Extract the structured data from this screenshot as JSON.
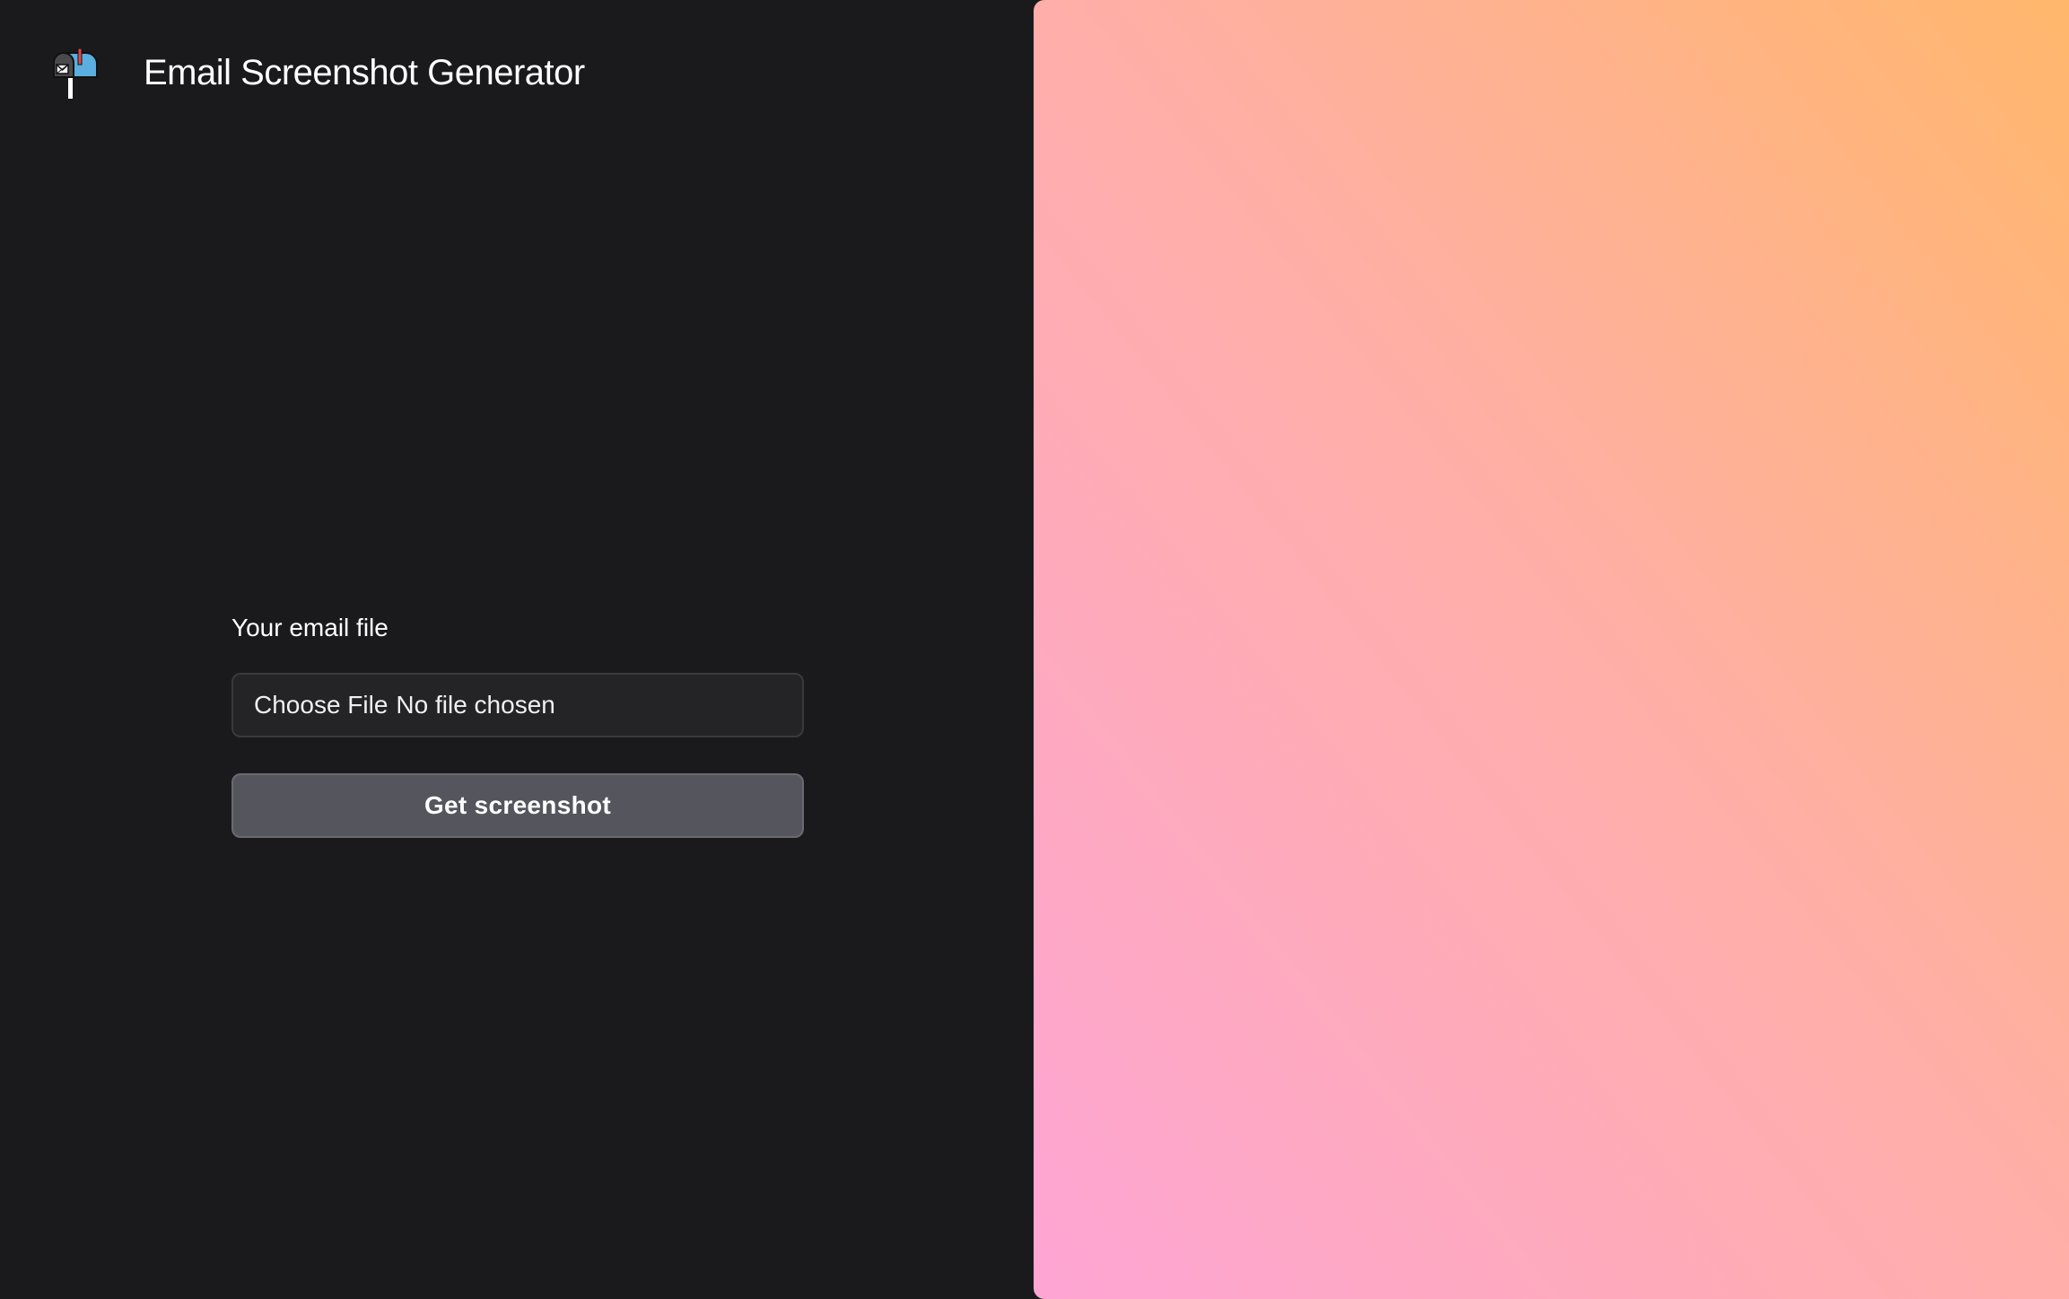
{
  "header": {
    "title": "Email Screenshot Generator",
    "logo_icon": "mailbox-icon"
  },
  "form": {
    "label": "Your email file",
    "file_input": {
      "button_label": "Choose File",
      "status": "No file chosen"
    },
    "submit_label": "Get screenshot"
  },
  "preview": {
    "gradient_colors": [
      "#fea5d4",
      "#ffaeaa",
      "#ffb76c"
    ]
  },
  "colors": {
    "background": "#1a1a1c",
    "input_background": "#242426",
    "button_background": "#55555d",
    "text": "#ffffff"
  }
}
